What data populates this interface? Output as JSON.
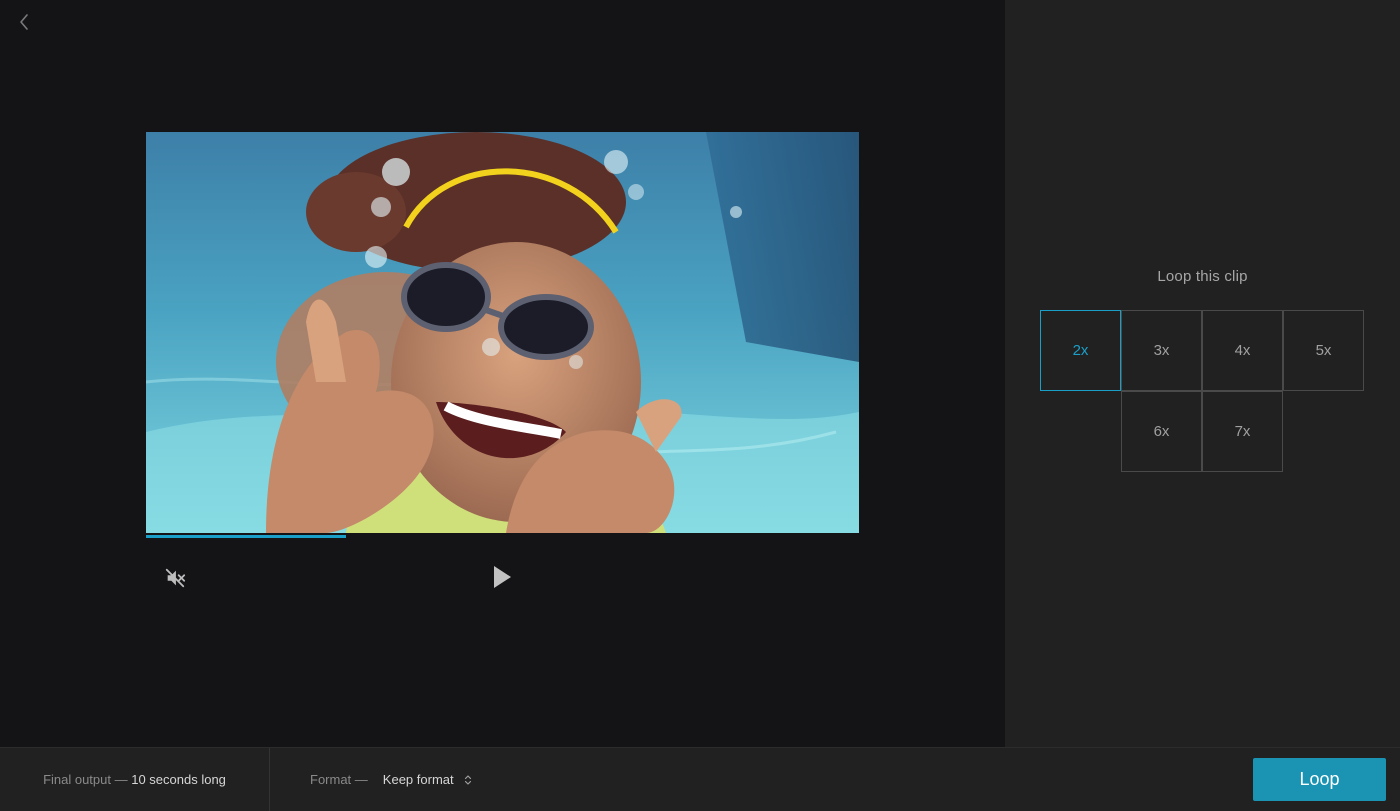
{
  "navigation": {
    "back_icon": "chevron-left-icon"
  },
  "video": {
    "thumbnail_description": "underwater swimmer thumbnail",
    "progress": 0.28,
    "mute_icon": "volume-muted-icon",
    "play_icon": "play-icon"
  },
  "loop_panel": {
    "title": "Loop this clip",
    "options": [
      "2x",
      "3x",
      "4x",
      "5x",
      "6x",
      "7x"
    ],
    "selected": "2x",
    "accent_color": "#1a9fc8"
  },
  "footer": {
    "output_label": "Final output —",
    "output_value": "10 seconds long",
    "format_label": "Format —",
    "format_value": "Keep format",
    "format_icon": "chevron-updown-icon",
    "loop_button_label": "Loop",
    "button_color": "#1b94b4"
  }
}
